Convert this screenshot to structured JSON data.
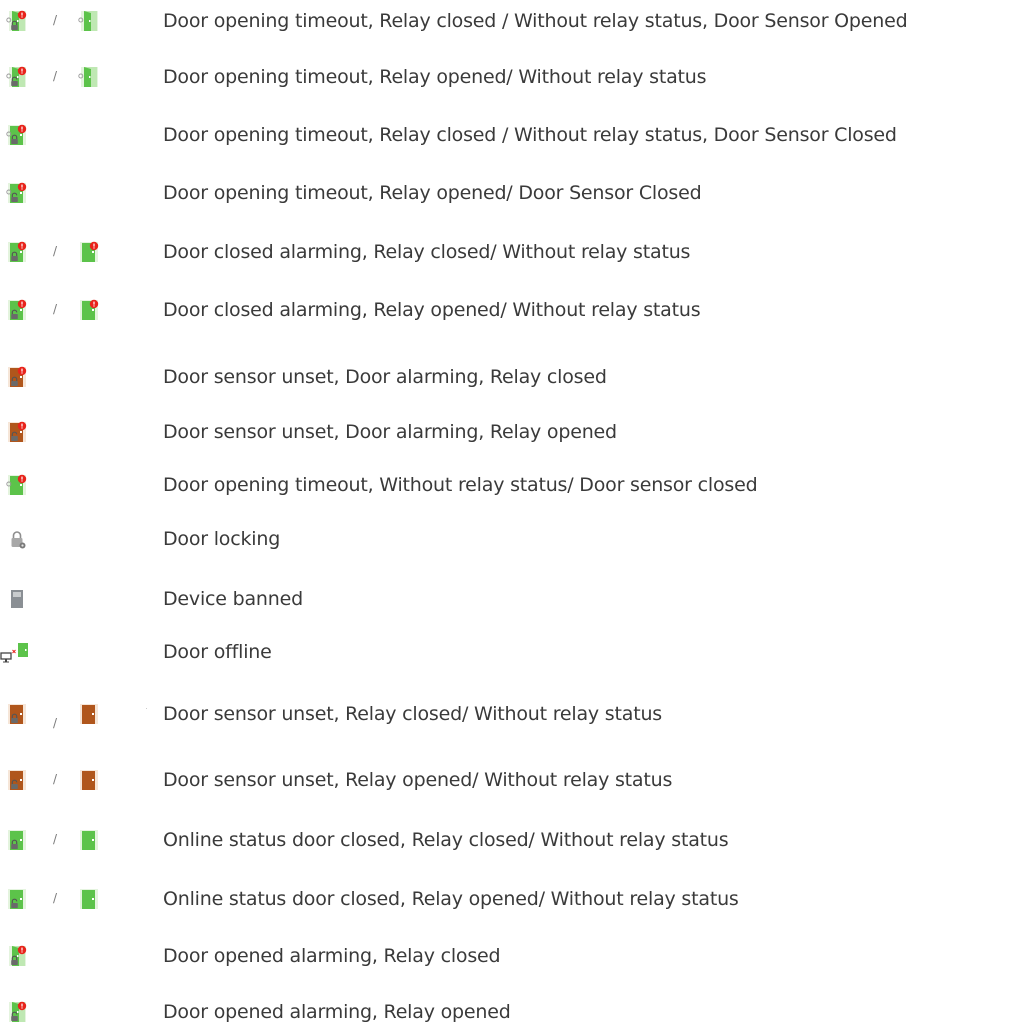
{
  "colors": {
    "green_door": "#5cc34a",
    "green_frame": "#8fd97e",
    "brown_door": "#b0561c",
    "brown_frame": "#cf8a4e",
    "grey_door": "#8a8f94",
    "alarm_red": "#e8231b",
    "lock_grey": "#6a6a6a",
    "text": "#3a3a3a"
  },
  "rows": [
    {
      "label": "Door opening timeout, Relay closed / Without relay status, Door Sensor Opened",
      "icon1": "green-door-timeout-alarm-relay-closed-icon",
      "icon2": "green-door-opened-timeout-icon",
      "separator": "/"
    },
    {
      "label": "Door opening timeout, Relay opened/ Without relay status",
      "icon1": "green-door-timeout-alarm-relay-opened-icon",
      "icon2": "green-door-opened-timeout-icon",
      "separator": "/"
    },
    {
      "label": "Door opening timeout, Relay closed / Without relay status, Door Sensor Closed",
      "icon1": "green-door-closed-timeout-alarm-relay-closed-icon",
      "icon2": "",
      "separator": ""
    },
    {
      "label": "Door opening timeout, Relay opened/ Door Sensor Closed",
      "icon1": "green-door-closed-timeout-alarm-relay-opened-icon",
      "icon2": "",
      "separator": ""
    },
    {
      "label": "Door closed alarming, Relay closed/ Without relay status",
      "icon1": "green-door-closed-alarm-relay-closed-icon",
      "icon2": "green-door-closed-alarm-icon",
      "separator": "/"
    },
    {
      "label": "Door closed alarming, Relay opened/ Without relay status",
      "icon1": "green-door-closed-alarm-relay-opened-icon",
      "icon2": "green-door-closed-alarm-icon",
      "separator": "/"
    },
    {
      "label": "Door sensor unset, Door alarming, Relay closed",
      "icon1": "brown-door-alarm-relay-closed-icon",
      "icon2": "",
      "separator": ""
    },
    {
      "label": "Door sensor unset, Door alarming, Relay opened",
      "icon1": "brown-door-alarm-relay-opened-icon",
      "icon2": "",
      "separator": ""
    },
    {
      "label": "Door opening timeout, Without relay status/ Door sensor closed",
      "icon1": "green-door-closed-timeout-alarm-icon",
      "icon2": "",
      "separator": ""
    },
    {
      "label": "Door locking",
      "icon1": "padlock-gear-icon",
      "icon2": "",
      "separator": ""
    },
    {
      "label": "Device banned",
      "icon1": "grey-door-banned-icon",
      "icon2": "",
      "separator": ""
    },
    {
      "label": "Door offline",
      "icon1": "monitor-offline-door-icon",
      "icon2": "",
      "separator": ""
    },
    {
      "label": "Door sensor unset, Relay closed/ Without relay status",
      "icon1": "brown-door-relay-closed-icon",
      "icon2": "brown-door-icon",
      "separator": "/"
    },
    {
      "label": "Door sensor unset, Relay opened/ Without relay status",
      "icon1": "brown-door-relay-opened-icon",
      "icon2": "brown-door-icon",
      "separator": "/"
    },
    {
      "label": "Online status door closed, Relay closed/ Without relay status",
      "icon1": "green-door-relay-closed-icon",
      "icon2": "green-door-icon",
      "separator": "/"
    },
    {
      "label": "Online status door closed, Relay opened/ Without relay status",
      "icon1": "green-door-relay-opened-icon",
      "icon2": "green-door-icon",
      "separator": "/"
    },
    {
      "label": "Door opened alarming, Relay closed",
      "icon1": "green-door-opened-alarm-relay-closed-icon",
      "icon2": "",
      "separator": ""
    },
    {
      "label": "Door opened alarming, Relay opened",
      "icon1": "green-door-opened-alarm-relay-opened-icon",
      "icon2": "",
      "separator": ""
    }
  ]
}
